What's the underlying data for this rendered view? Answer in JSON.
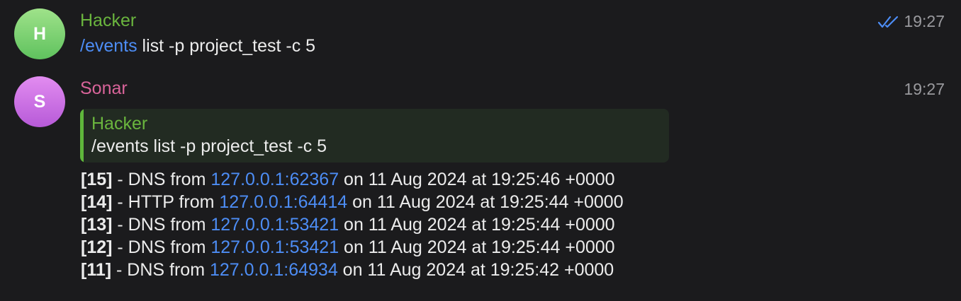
{
  "colors": {
    "background": "#1b1b1d",
    "hacker_name": "#6ab53e",
    "sonar_name": "#d9649a",
    "link": "#4d8df5",
    "quote_bar": "#5fb73b",
    "quote_bg": "#222b22"
  },
  "messages": [
    {
      "avatar_letter": "H",
      "sender": "Hacker",
      "time": "19:27",
      "status_icon": "double-check-icon",
      "command": "/events",
      "args": " list -p project_test -c 5"
    },
    {
      "avatar_letter": "S",
      "sender": "Sonar",
      "time": "19:27",
      "reply": {
        "sender": "Hacker",
        "text": "/events list -p project_test -c 5"
      },
      "events": [
        {
          "id": "[15]",
          "pre": " - DNS from ",
          "addr": "127.0.0.1:62367",
          "post": " on 11 Aug 2024 at 19:25:46 +0000"
        },
        {
          "id": "[14]",
          "pre": " - HTTP from ",
          "addr": "127.0.0.1:64414",
          "post": " on 11 Aug 2024 at 19:25:44 +0000"
        },
        {
          "id": "[13]",
          "pre": " - DNS from ",
          "addr": "127.0.0.1:53421",
          "post": " on 11 Aug 2024 at 19:25:44 +0000"
        },
        {
          "id": "[12]",
          "pre": " - DNS from ",
          "addr": "127.0.0.1:53421",
          "post": " on 11 Aug 2024 at 19:25:44 +0000"
        },
        {
          "id": "[11]",
          "pre": " - DNS from ",
          "addr": "127.0.0.1:64934",
          "post": " on 11 Aug 2024 at 19:25:42 +0000"
        }
      ]
    }
  ]
}
